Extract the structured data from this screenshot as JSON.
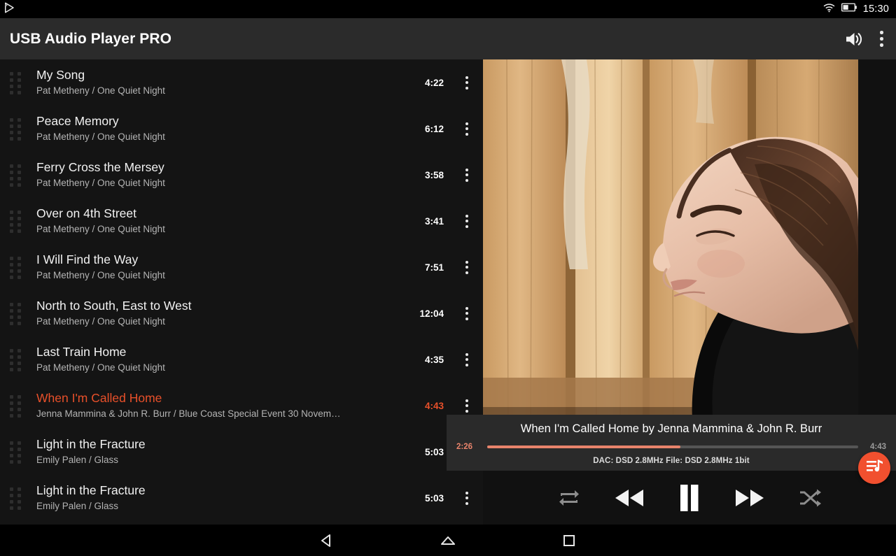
{
  "statusbar": {
    "app_icon": "play-notification-icon",
    "wifi_icon": "wifi-icon",
    "battery_icon": "battery-icon",
    "clock": "15:30"
  },
  "appbar": {
    "title": "USB Audio Player PRO",
    "volume_icon": "volume-up-icon",
    "overflow_icon": "overflow-menu-icon"
  },
  "colors": {
    "accent": "#f1502f",
    "playing_text": "#e8502a",
    "progress": "#e8836b",
    "appbar_bg": "#2b2b2b",
    "panel_bg": "#2a2a2a",
    "list_bg": "#141414"
  },
  "tracklist": [
    {
      "title": "My Song",
      "subtitle": "Pat Metheny / One Quiet Night",
      "duration": "4:22",
      "playing": false
    },
    {
      "title": "Peace Memory",
      "subtitle": "Pat Metheny / One Quiet Night",
      "duration": "6:12",
      "playing": false
    },
    {
      "title": "Ferry Cross the Mersey",
      "subtitle": "Pat Metheny / One Quiet Night",
      "duration": "3:58",
      "playing": false
    },
    {
      "title": "Over on 4th Street",
      "subtitle": "Pat Metheny / One Quiet Night",
      "duration": "3:41",
      "playing": false
    },
    {
      "title": "I Will Find the Way",
      "subtitle": "Pat Metheny / One Quiet Night",
      "duration": "7:51",
      "playing": false
    },
    {
      "title": "North to South, East to West",
      "subtitle": "Pat Metheny / One Quiet Night",
      "duration": "12:04",
      "playing": false
    },
    {
      "title": "Last Train Home",
      "subtitle": "Pat Metheny / One Quiet Night",
      "duration": "4:35",
      "playing": false
    },
    {
      "title": "When I'm Called Home",
      "subtitle": "Jenna Mammina & John R. Burr / Blue Coast Special Event 30 Novem…",
      "duration": "4:43",
      "playing": true
    },
    {
      "title": "Light in the Fracture",
      "subtitle": "Emily Palen / Glass",
      "duration": "5:03",
      "playing": false
    },
    {
      "title": "Light in the Fracture",
      "subtitle": "Emily Palen / Glass",
      "duration": "5:03",
      "playing": false
    }
  ],
  "album_art": {
    "name": "album-art",
    "description": "Woman in profile with eyes closed against weathered wooden fence"
  },
  "player": {
    "now_playing": "When I'm Called Home by Jenna Mammina & John R. Burr",
    "elapsed": "2:26",
    "total": "4:43",
    "progress_percent": 52,
    "dac_info": "DAC: DSD 2.8MHz   File: DSD 2.8MHz   1bit"
  },
  "transport": {
    "repeat_icon": "repeat-icon",
    "rewind_icon": "rewind-icon",
    "pause_icon": "pause-icon",
    "fastforward_icon": "fast-forward-icon",
    "shuffle_icon": "shuffle-icon"
  },
  "fab": {
    "icon": "queue-music-icon"
  },
  "navbar": {
    "back_icon": "back-triangle-icon",
    "home_icon": "home-icon",
    "recents_icon": "recents-square-icon"
  }
}
